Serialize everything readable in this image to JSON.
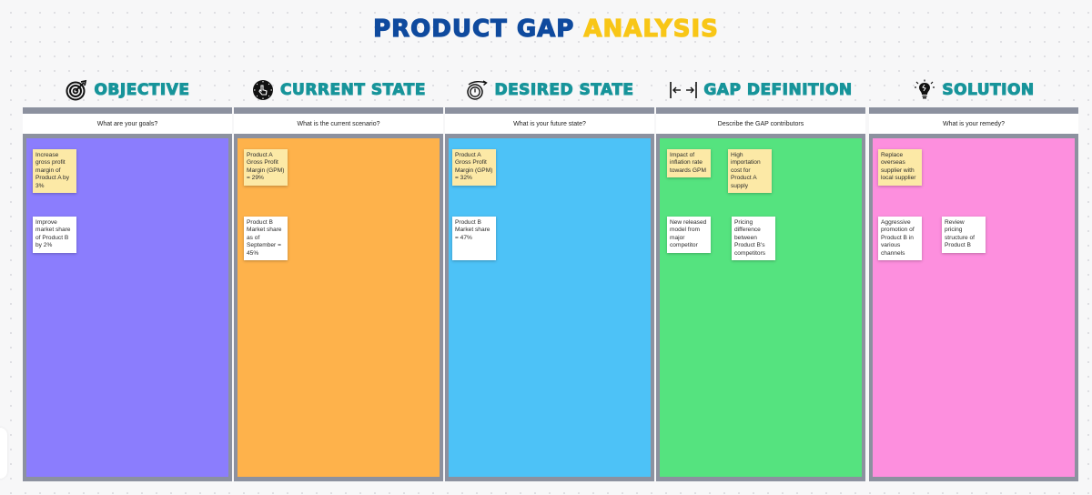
{
  "title": {
    "part1": "PRODUCT GAP ",
    "part2": "ANALYSIS",
    "part1_color": "#0f4a9e",
    "part2_color": "#f8c617"
  },
  "columns": [
    {
      "heading": "OBJECTIVE",
      "icon": "target-icon",
      "question": "What are your goals?",
      "color": "#8b7dfd",
      "notes": [
        {
          "text": "Increase gross profit margin of Product A by 3%",
          "color": "yellow"
        },
        {
          "text": "Improve market share of Product B by 2%",
          "color": "white"
        }
      ]
    },
    {
      "heading": "CURRENT STATE",
      "icon": "touch-clock-icon",
      "question": "What is the current scenario?",
      "color": "#feb24b",
      "notes": [
        {
          "text": "Product A Gross Profit Margin (GPM) = 29%",
          "color": "yellow"
        },
        {
          "text": "Product B Market share as of September = 45%",
          "color": "white"
        }
      ]
    },
    {
      "heading": "DESIRED STATE",
      "icon": "clock-arrow-icon",
      "question": "What is your future state?",
      "color": "#4dc2f7",
      "notes": [
        {
          "text": "Product A Gross Profit Margin (GPM) = 32%",
          "color": "yellow"
        },
        {
          "text": "Product B Market share = 47%",
          "color": "white"
        }
      ]
    },
    {
      "heading": "GAP DEFINITION",
      "icon": "gap-arrows-icon",
      "question": "Describe the GAP contributors",
      "color": "#55e37f",
      "notes": [
        {
          "text": "Impact of inflation rate towards GPM",
          "color": "yellow"
        },
        {
          "text": "High importation cost for Product A supply",
          "color": "yellow"
        },
        {
          "text": "New released model from major competitor",
          "color": "white"
        },
        {
          "text": "Pricing difference between Product B's competitors",
          "color": "white"
        }
      ]
    },
    {
      "heading": "SOLUTION",
      "icon": "lightbulb-icon",
      "question": "What is your remedy?",
      "color": "#fd8fde",
      "notes": [
        {
          "text": "Replace overseas supplier with local supplier",
          "color": "yellow"
        },
        {
          "text": "Aggressive promotion of Product B in various channels",
          "color": "white"
        },
        {
          "text": "Review pricing structure of Product B",
          "color": "white"
        }
      ]
    }
  ]
}
